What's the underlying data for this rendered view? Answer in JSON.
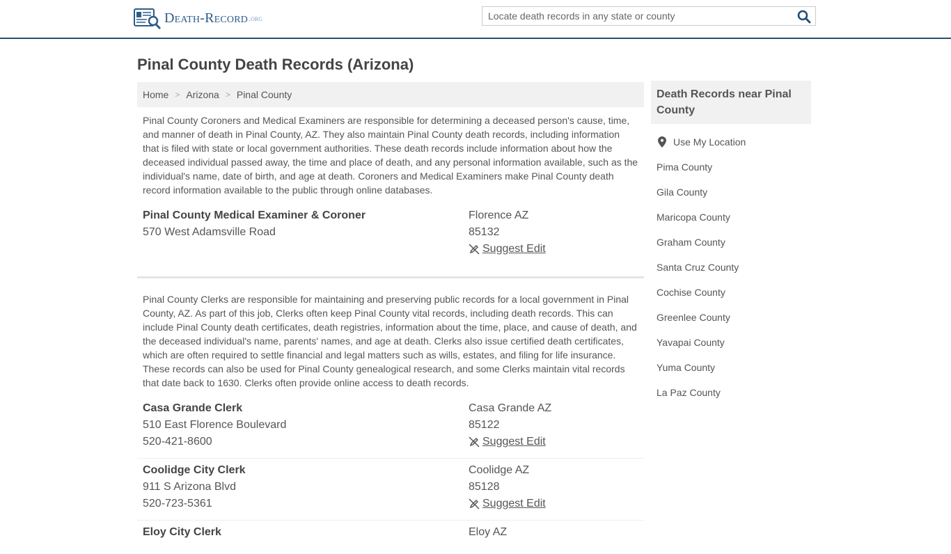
{
  "header": {
    "logo_text": "Death-Record",
    "logo_tld": ".org",
    "search_placeholder": "Locate death records in any state or county"
  },
  "page": {
    "title": "Pinal County Death Records (Arizona)"
  },
  "breadcrumb": [
    "Home",
    "Arizona",
    "Pinal County"
  ],
  "sections": [
    {
      "description": "Pinal County Coroners and Medical Examiners are responsible for determining a deceased person's cause, time, and manner of death in Pinal County, AZ. They also maintain Pinal County death records, including information that is filed with state or local government authorities. These death records include information about how the deceased individual passed away, the time and place of death, and any personal information available, such as the individual's name, date of birth, and age at death. Coroners and Medical Examiners make Pinal County death record information available to the public through online databases.",
      "offices": [
        {
          "name": "Pinal County Medical Examiner & Coroner",
          "address": "570 West Adamsville Road",
          "phone": "",
          "city": "Florence AZ",
          "zip": "85132",
          "edit": "Suggest Edit"
        }
      ]
    },
    {
      "description": "Pinal County Clerks are responsible for maintaining and preserving public records for a local government in Pinal County, AZ. As part of this job, Clerks often keep Pinal County vital records, including death records. This can include Pinal County death certificates, death registries, information about the time, place, and cause of death, and the deceased individual's name, parents' names, and age at death. Clerks also issue certified death certificates, which are often required to settle financial and legal matters such as wills, estates, and filing for life insurance. These records can also be used for Pinal County genealogical research, and some Clerks maintain vital records that date back to 1630. Clerks often provide online access to death records.",
      "offices": [
        {
          "name": "Casa Grande Clerk",
          "address": "510 East Florence Boulevard",
          "phone": "520-421-8600",
          "city": "Casa Grande AZ",
          "zip": "85122",
          "edit": "Suggest Edit"
        },
        {
          "name": "Coolidge City Clerk",
          "address": "911 S Arizona Blvd",
          "phone": "520-723-5361",
          "city": "Coolidge AZ",
          "zip": "85128",
          "edit": "Suggest Edit"
        },
        {
          "name": "Eloy City Clerk",
          "address": "",
          "phone": "",
          "city": "Eloy AZ",
          "zip": "",
          "edit": ""
        }
      ]
    }
  ],
  "sidebar": {
    "heading": "Death Records near Pinal County",
    "location_label": "Use My Location",
    "counties": [
      "Pima County",
      "Gila County",
      "Maricopa County",
      "Graham County",
      "Santa Cruz County",
      "Cochise County",
      "Greenlee County",
      "Yavapai County",
      "Yuma County",
      "La Paz County"
    ]
  },
  "colors": {
    "header_rule": "#26506e",
    "logo_blue": "#2d5c8a",
    "search_icon": "#1f4e79",
    "panel_bg": "#f1f1f1"
  }
}
